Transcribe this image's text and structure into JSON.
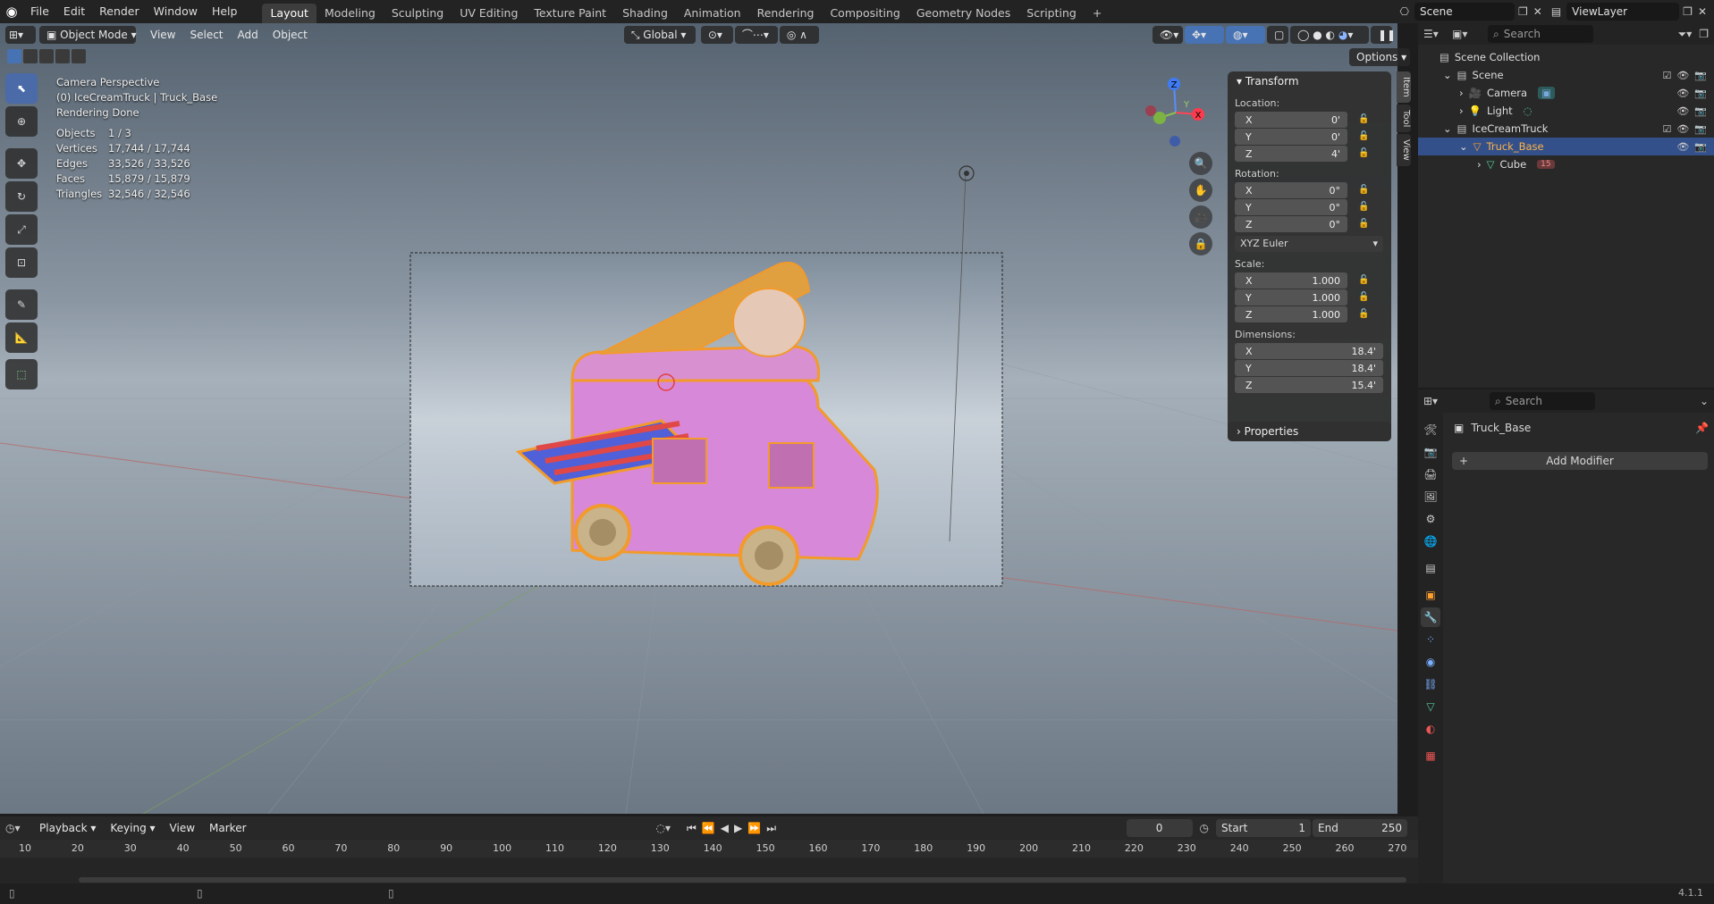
{
  "topbar": {
    "menus": [
      "File",
      "Edit",
      "Render",
      "Window",
      "Help"
    ],
    "workspaces": [
      "Layout",
      "Modeling",
      "Sculpting",
      "UV Editing",
      "Texture Paint",
      "Shading",
      "Animation",
      "Rendering",
      "Compositing",
      "Geometry Nodes",
      "Scripting"
    ],
    "active_workspace": "Layout",
    "add_tab": "+",
    "scene_name": "Scene",
    "view_layer": "ViewLayer"
  },
  "viewport": {
    "mode": "Object Mode",
    "menus": [
      "View",
      "Select",
      "Add",
      "Object"
    ],
    "orientation": "Global",
    "options_label": "Options",
    "overlay": {
      "view_name": "Camera Perspective",
      "object_line": "(0) IceCreamTruck | Truck_Base",
      "render_status": "Rendering Done"
    },
    "stats": [
      {
        "k": "Objects",
        "v": "1 / 3"
      },
      {
        "k": "Vertices",
        "v": "17,744 / 17,744"
      },
      {
        "k": "Edges",
        "v": "33,526 / 33,526"
      },
      {
        "k": "Faces",
        "v": "15,879 / 15,879"
      },
      {
        "k": "Triangles",
        "v": "32,546 / 32,546"
      }
    ],
    "gizmo": {
      "z": "Z",
      "y": "Y",
      "x": "X"
    },
    "side_tabs": [
      "Item",
      "Tool",
      "View"
    ]
  },
  "npanel": {
    "title": "Transform",
    "location_label": "Location:",
    "location": [
      {
        "axis": "X",
        "value": "0'"
      },
      {
        "axis": "Y",
        "value": "0'"
      },
      {
        "axis": "Z",
        "value": "4'"
      }
    ],
    "rotation_label": "Rotation:",
    "rotation": [
      {
        "axis": "X",
        "value": "0°"
      },
      {
        "axis": "Y",
        "value": "0°"
      },
      {
        "axis": "Z",
        "value": "0°"
      }
    ],
    "rotation_mode": "XYZ Euler",
    "scale_label": "Scale:",
    "scale": [
      {
        "axis": "X",
        "value": "1.000"
      },
      {
        "axis": "Y",
        "value": "1.000"
      },
      {
        "axis": "Z",
        "value": "1.000"
      }
    ],
    "dimensions_label": "Dimensions:",
    "dimensions": [
      {
        "axis": "X",
        "value": "18.4'"
      },
      {
        "axis": "Y",
        "value": "18.4'"
      },
      {
        "axis": "Z",
        "value": "15.4'"
      }
    ],
    "properties_label": "Properties"
  },
  "outliner": {
    "search_placeholder": "Search",
    "rows": [
      {
        "label": "Scene Collection",
        "indent": 0
      },
      {
        "label": "Scene",
        "indent": 1
      },
      {
        "label": "Camera",
        "indent": 2
      },
      {
        "label": "Light",
        "indent": 2
      },
      {
        "label": "IceCreamTruck",
        "indent": 1
      },
      {
        "label": "Truck_Base",
        "indent": 2
      },
      {
        "label": "Cube",
        "indent": 3
      }
    ],
    "cube_badge": "15"
  },
  "properties": {
    "search_placeholder": "Search",
    "object_name": "Truck_Base",
    "add_modifier": "Add Modifier"
  },
  "timeline": {
    "menus": [
      "Playback",
      "Keying",
      "View",
      "Marker"
    ],
    "current_frame": "0",
    "start_label": "Start",
    "start_value": "1",
    "end_label": "End",
    "end_value": "250",
    "ticks": [
      "10",
      "20",
      "30",
      "40",
      "50",
      "60",
      "70",
      "80",
      "90",
      "100",
      "110",
      "120",
      "130",
      "140",
      "150",
      "160",
      "170",
      "180",
      "190",
      "200",
      "210",
      "220",
      "230",
      "240",
      "250",
      "260",
      "270"
    ]
  },
  "statusbar": {
    "version": "4.1.1"
  },
  "colors": {
    "accent": "#4772b3",
    "selection": "#ff9f2e",
    "header": "#232323",
    "panel": "#282828"
  }
}
